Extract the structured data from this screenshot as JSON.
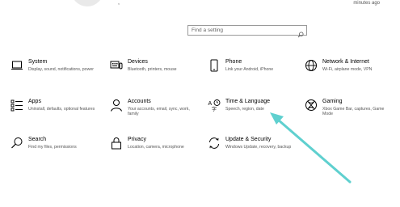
{
  "header": {
    "update_time": "minutes ago"
  },
  "search": {
    "placeholder": "Find a setting"
  },
  "tiles": [
    {
      "title": "System",
      "desc": "Display, sound, notifications, power",
      "icon": "laptop-icon"
    },
    {
      "title": "Devices",
      "desc": "Bluetooth, printers, mouse",
      "icon": "keyboard-icon"
    },
    {
      "title": "Phone",
      "desc": "Link your Android, iPhone",
      "icon": "phone-icon"
    },
    {
      "title": "Network & Internet",
      "desc": "Wi-Fi, airplane mode, VPN",
      "icon": "globe-icon"
    },
    {
      "title": "Apps",
      "desc": "Uninstall, defaults, optional features",
      "icon": "apps-list-icon"
    },
    {
      "title": "Accounts",
      "desc": "Your accounts, email, sync, work, family",
      "icon": "person-icon"
    },
    {
      "title": "Time & Language",
      "desc": "Speech, region, date",
      "icon": "time-language-icon"
    },
    {
      "title": "Gaming",
      "desc": "Xbox Game Bar, captures, Game Mode",
      "icon": "xbox-icon"
    },
    {
      "title": "Search",
      "desc": "Find my files, permissions",
      "icon": "search-icon"
    },
    {
      "title": "Privacy",
      "desc": "Location, camera, microphone",
      "icon": "lock-icon"
    },
    {
      "title": "Update & Security",
      "desc": "Windows Update, recovery, backup",
      "icon": "sync-icon"
    }
  ],
  "colors": {
    "annotation_arrow": "#5fd0cf"
  }
}
